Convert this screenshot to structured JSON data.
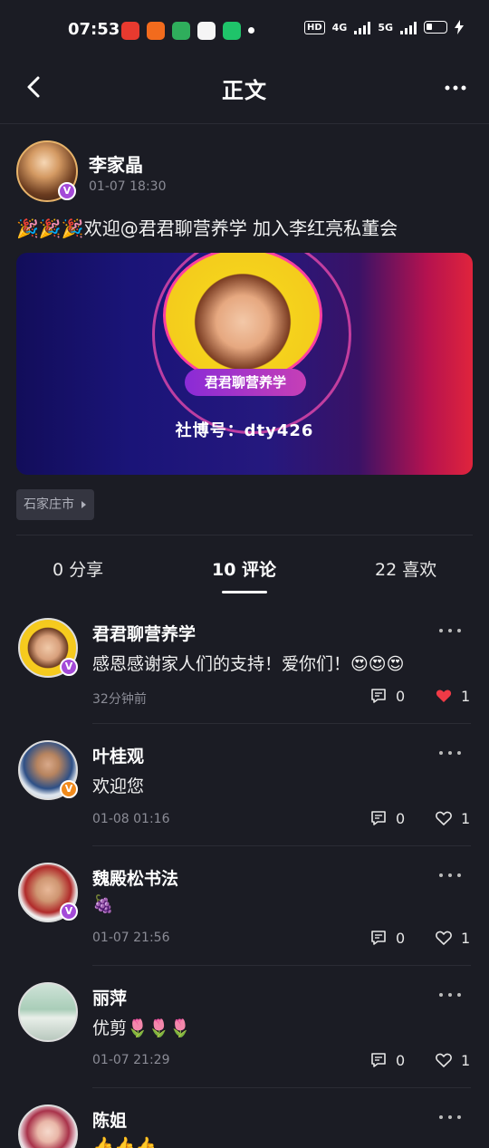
{
  "status_bar": {
    "time": "07:53",
    "hd": "HD",
    "net1": "4G",
    "net2": "5G"
  },
  "nav": {
    "title": "正文"
  },
  "post": {
    "author": "李家晶",
    "time": "01-07 18:30",
    "text": "🎉🎉🎉欢迎@君君聊营养学 加入李红亮私董会",
    "banner": {
      "name": "君君聊营养学",
      "id_text": "社博号：dty426"
    },
    "location": "石家庄市"
  },
  "tabs": [
    {
      "label": "0 分享"
    },
    {
      "label": "10 评论"
    },
    {
      "label": "22 喜欢"
    }
  ],
  "comments": [
    {
      "name": "君君聊营养学",
      "text": "感恩感谢家人们的支持！爱你们！😍😍😍",
      "time": "32分钟前",
      "reply_count": "0",
      "like_count": "1",
      "liked": true
    },
    {
      "name": "叶桂观",
      "text": "欢迎您",
      "time": "01-08 01:16",
      "reply_count": "0",
      "like_count": "1",
      "liked": false
    },
    {
      "name": "魏殿松书法",
      "text": "🍇",
      "time": "01-07 21:56",
      "reply_count": "0",
      "like_count": "1",
      "liked": false
    },
    {
      "name": "丽萍",
      "text": "优剪🌷🌷🌷",
      "time": "01-07 21:29",
      "reply_count": "0",
      "like_count": "1",
      "liked": false
    },
    {
      "name": "陈姐",
      "text": "👍👍👍",
      "time": "",
      "reply_count": "",
      "like_count": "",
      "liked": false
    }
  ],
  "colors": {
    "background": "#1b1c24",
    "like_red": "#f03a46",
    "vip_purple": "#a44ad8",
    "vip_orange": "#f08a1c"
  }
}
